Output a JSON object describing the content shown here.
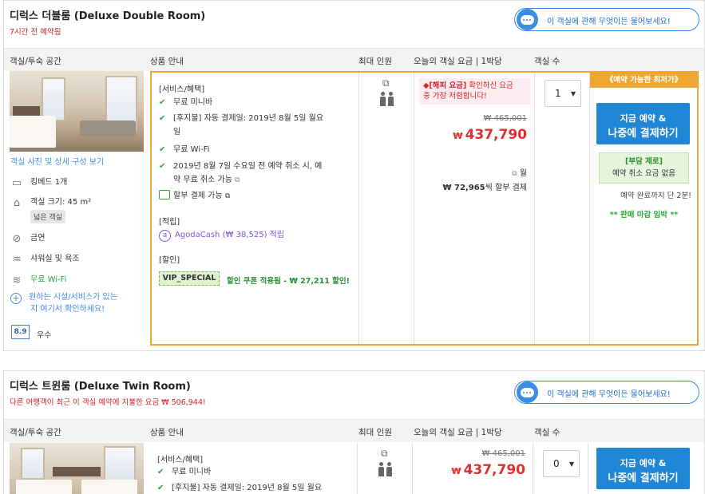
{
  "columns": {
    "room": "객실/투숙 공간",
    "product": "상품 안내",
    "occupancy": "최대 인원",
    "price": "오늘의 객실 요금 | 1박당",
    "rooms": "객실 수"
  },
  "ask_button": "이 객실에 관해 무엇이든 물어보세요!",
  "room1": {
    "title": "디럭스 더블룸 (Deluxe Double Room)",
    "subtitle": "7시간 전 예약됨",
    "photo_link": "객실 사진 및 상세 구성 보기",
    "amenities": {
      "bed": "킹베드 1개",
      "size": "객실 크기: 45 m²",
      "size_tag": "넓은 객실",
      "nosmoke": "금연",
      "shower": "샤워실 및 욕조",
      "wifi": "무료 Wi-Fi",
      "more_line1": "원하는 시설/서비스가 있는",
      "more_line2": "지 여기서 확인하세요!"
    },
    "score": "8.9",
    "score_label": "우수",
    "benefits_head": "[서비스/혜택]",
    "benefits": {
      "b1": "무료 미니바",
      "b2_l1": "[후지불] 자동 결제일: 2019년 8월 5일 월요",
      "b2_l2": "일",
      "b3": "무료 Wi-Fi",
      "b4_l1": "2019년 8월 7일 수요일 전 예약 취소 시, 예",
      "b4_l2": "약 무료 취소 가능",
      "installment": "할부 결제 가능"
    },
    "points_head": "[적립]",
    "points": "AgodaCash (₩ 38,525) 적립",
    "discount_head": "[할인]",
    "vip": "VIP_SPECIAL",
    "vip_text": "할인 쿠폰 적용됨 - ₩ 27,211 할인!",
    "happy_label": "[해피 요금]",
    "happy_text1": " 확인하신 요금",
    "happy_text2": "중 가장 저렴합니다!",
    "orig_price": "₩ 465,001",
    "price_symbol": "₩",
    "price": "437,790",
    "monthly_unit": "월",
    "monthly_amount": "₩ 72,965",
    "monthly_suffix": "씩 할부 결제",
    "qty": "1",
    "cheapest": "《예약 가능한 최저가》",
    "book_l1": "지금 예약 &",
    "book_l2": "나중에 결제하기",
    "zero_head": "[부담 제로]",
    "zero_text": "예약 취소 요금 없음",
    "left_note": "예약 완료까지 단 2분!",
    "sellout": "** 판매 마감 임박 **"
  },
  "room2": {
    "title": "디럭스 트윈룸 (Deluxe Twin Room)",
    "subtitle": "다른 여행객이 최근 이 객실 예약에 지불한 요금 ₩ 506,944!",
    "benefits_head": "[서비스/혜택]",
    "b1": "무료 미니바",
    "b2": "[후지불] 자동 결제일: 2019년 8월 5일 월요",
    "orig_price": "₩ 465,001",
    "price_symbol": "₩",
    "price": "437,790",
    "qty": "0",
    "book_l1": "지금 예약 &",
    "book_l2": "나중에 결제하기"
  },
  "icons": [
    "chat-icon",
    "bed-icon",
    "house-icon",
    "no-smoking-icon",
    "shower-icon",
    "wifi-icon",
    "plus-circle-icon",
    "check-icon",
    "tag-icon",
    "people-icon",
    "external-link-icon"
  ]
}
